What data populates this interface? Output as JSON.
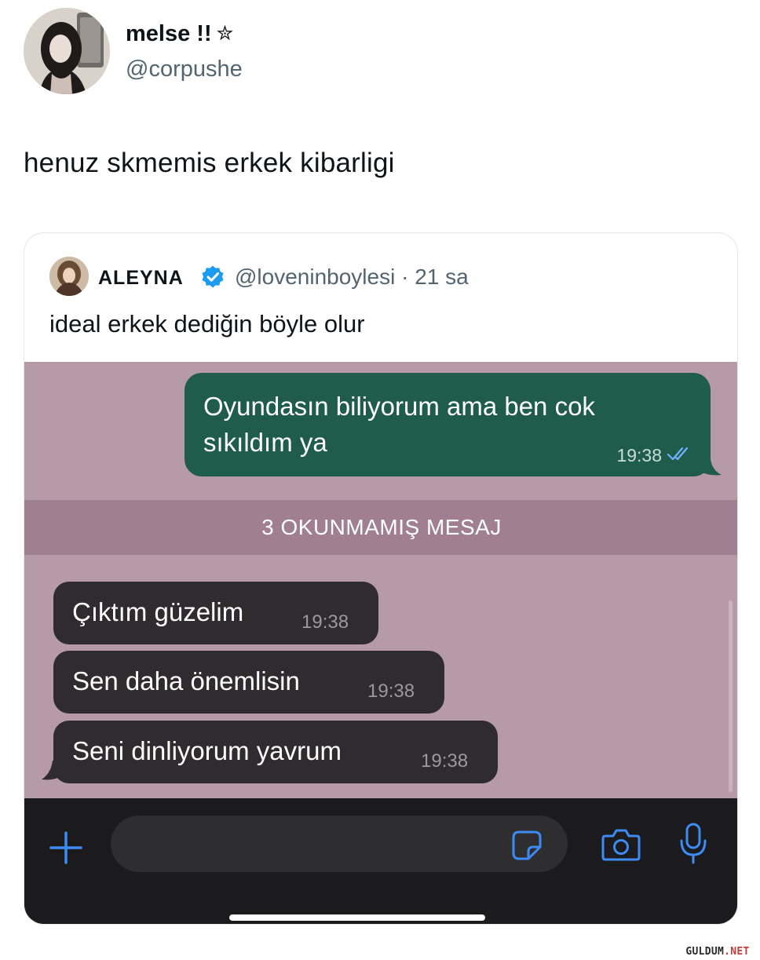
{
  "tweet": {
    "display_name": "melse !!",
    "star": "✮",
    "handle": "@corpushe",
    "text": "henuz skmemis erkek kibarligi"
  },
  "quoted_tweet": {
    "name": "ALEYNA",
    "handle_time": "@loveninboylesi · 21 sa",
    "text": "ideal erkek dediğin böyle olur",
    "chat": {
      "outgoing": {
        "text": "Oyundasın biliyorum ama ben cok sıkıldım ya",
        "time": "19:38"
      },
      "unread_banner": "3 OKUNMAMIŞ MESAJ",
      "incoming": [
        {
          "text": "Çıktım güzelim",
          "time": "19:38"
        },
        {
          "text": "Sen daha önemlisin",
          "time": "19:38"
        },
        {
          "text": "Seni dinliyorum yavrum",
          "time": "19:38"
        }
      ],
      "composer_placeholder": ""
    }
  },
  "watermark": {
    "part1": "GULDUM",
    "part2": ".NET"
  },
  "colors": {
    "chat_background": "#b79aa8",
    "outgoing_bubble": "#1f5c4b",
    "incoming_bubble": "#2f2b2f",
    "unread_bar": "#9f7f91",
    "accent_blue": "#3d8cf5"
  }
}
